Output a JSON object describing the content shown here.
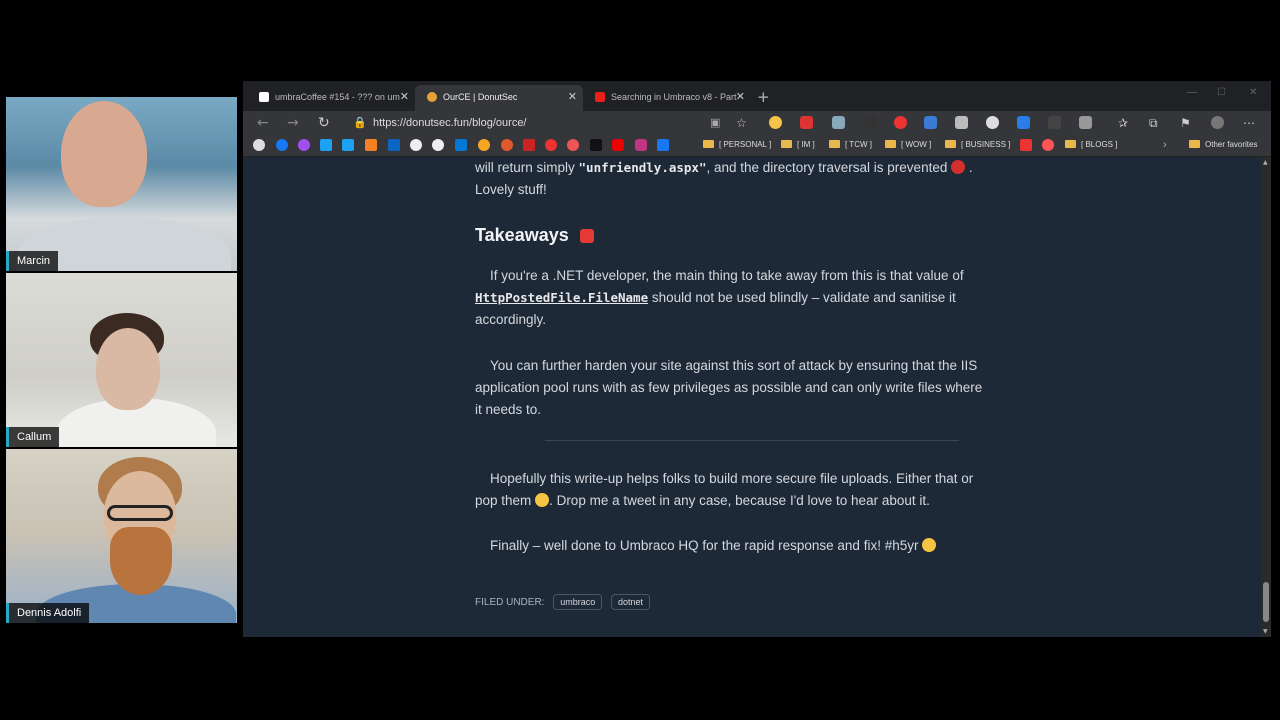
{
  "participants": [
    {
      "name": "Marcin"
    },
    {
      "name": "Callum"
    },
    {
      "name": "Dennis Adolfi"
    }
  ],
  "browser": {
    "tabs": [
      {
        "title": "umbraCoffee #154 - ??? on um",
        "favicon_color": "#ffffff"
      },
      {
        "title": "OurCE | DonutSec",
        "favicon_color": "#e8a23a"
      },
      {
        "title": "Searching in Umbraco v8 - Part",
        "favicon_color": "#e62117"
      }
    ],
    "new_tab_label": "+",
    "url": "https://donutsec.fun/blog/ource/",
    "bookmarks": {
      "folders": [
        "[ PERSONAL ]",
        "[ IM ]",
        "[ TCW ]",
        "[ WOW ]",
        "[ BUSINESS ]",
        "[ BLOGS ]"
      ],
      "other": "Other favorites"
    }
  },
  "article": {
    "line1_prefix": "will return simply ",
    "line1_code": "\"unfriendly.aspx\"",
    "line1_suffix": ", and the directory traversal is prevented",
    "line2": "Lovely stuff!",
    "heading": "Takeaways",
    "p1_a": "If you're a .NET developer, the main thing to take away from this is that value of",
    "p1_code": "HttpPostedFile.FileName",
    "p1_b": " should not be used blindly – validate and sanitise it",
    "p1_c": "accordingly.",
    "p2_a": "You can further harden your site against this sort of attack by ensuring that the IIS",
    "p2_b": "application pool runs with as few privileges as possible and can only write files where",
    "p2_c": "it needs to.",
    "p3_a": "Hopefully this write-up helps folks to build more secure file uploads. Either that or",
    "p3_b1": "pop them",
    "p3_b2": ". Drop me a tweet in any case, because I'd love to hear about it.",
    "p4": "Finally – well done to Umbraco HQ for the rapid response and fix! #h5yr",
    "filed_under": "FILED UNDER:",
    "tags": [
      "umbraco",
      "dotnet"
    ]
  }
}
